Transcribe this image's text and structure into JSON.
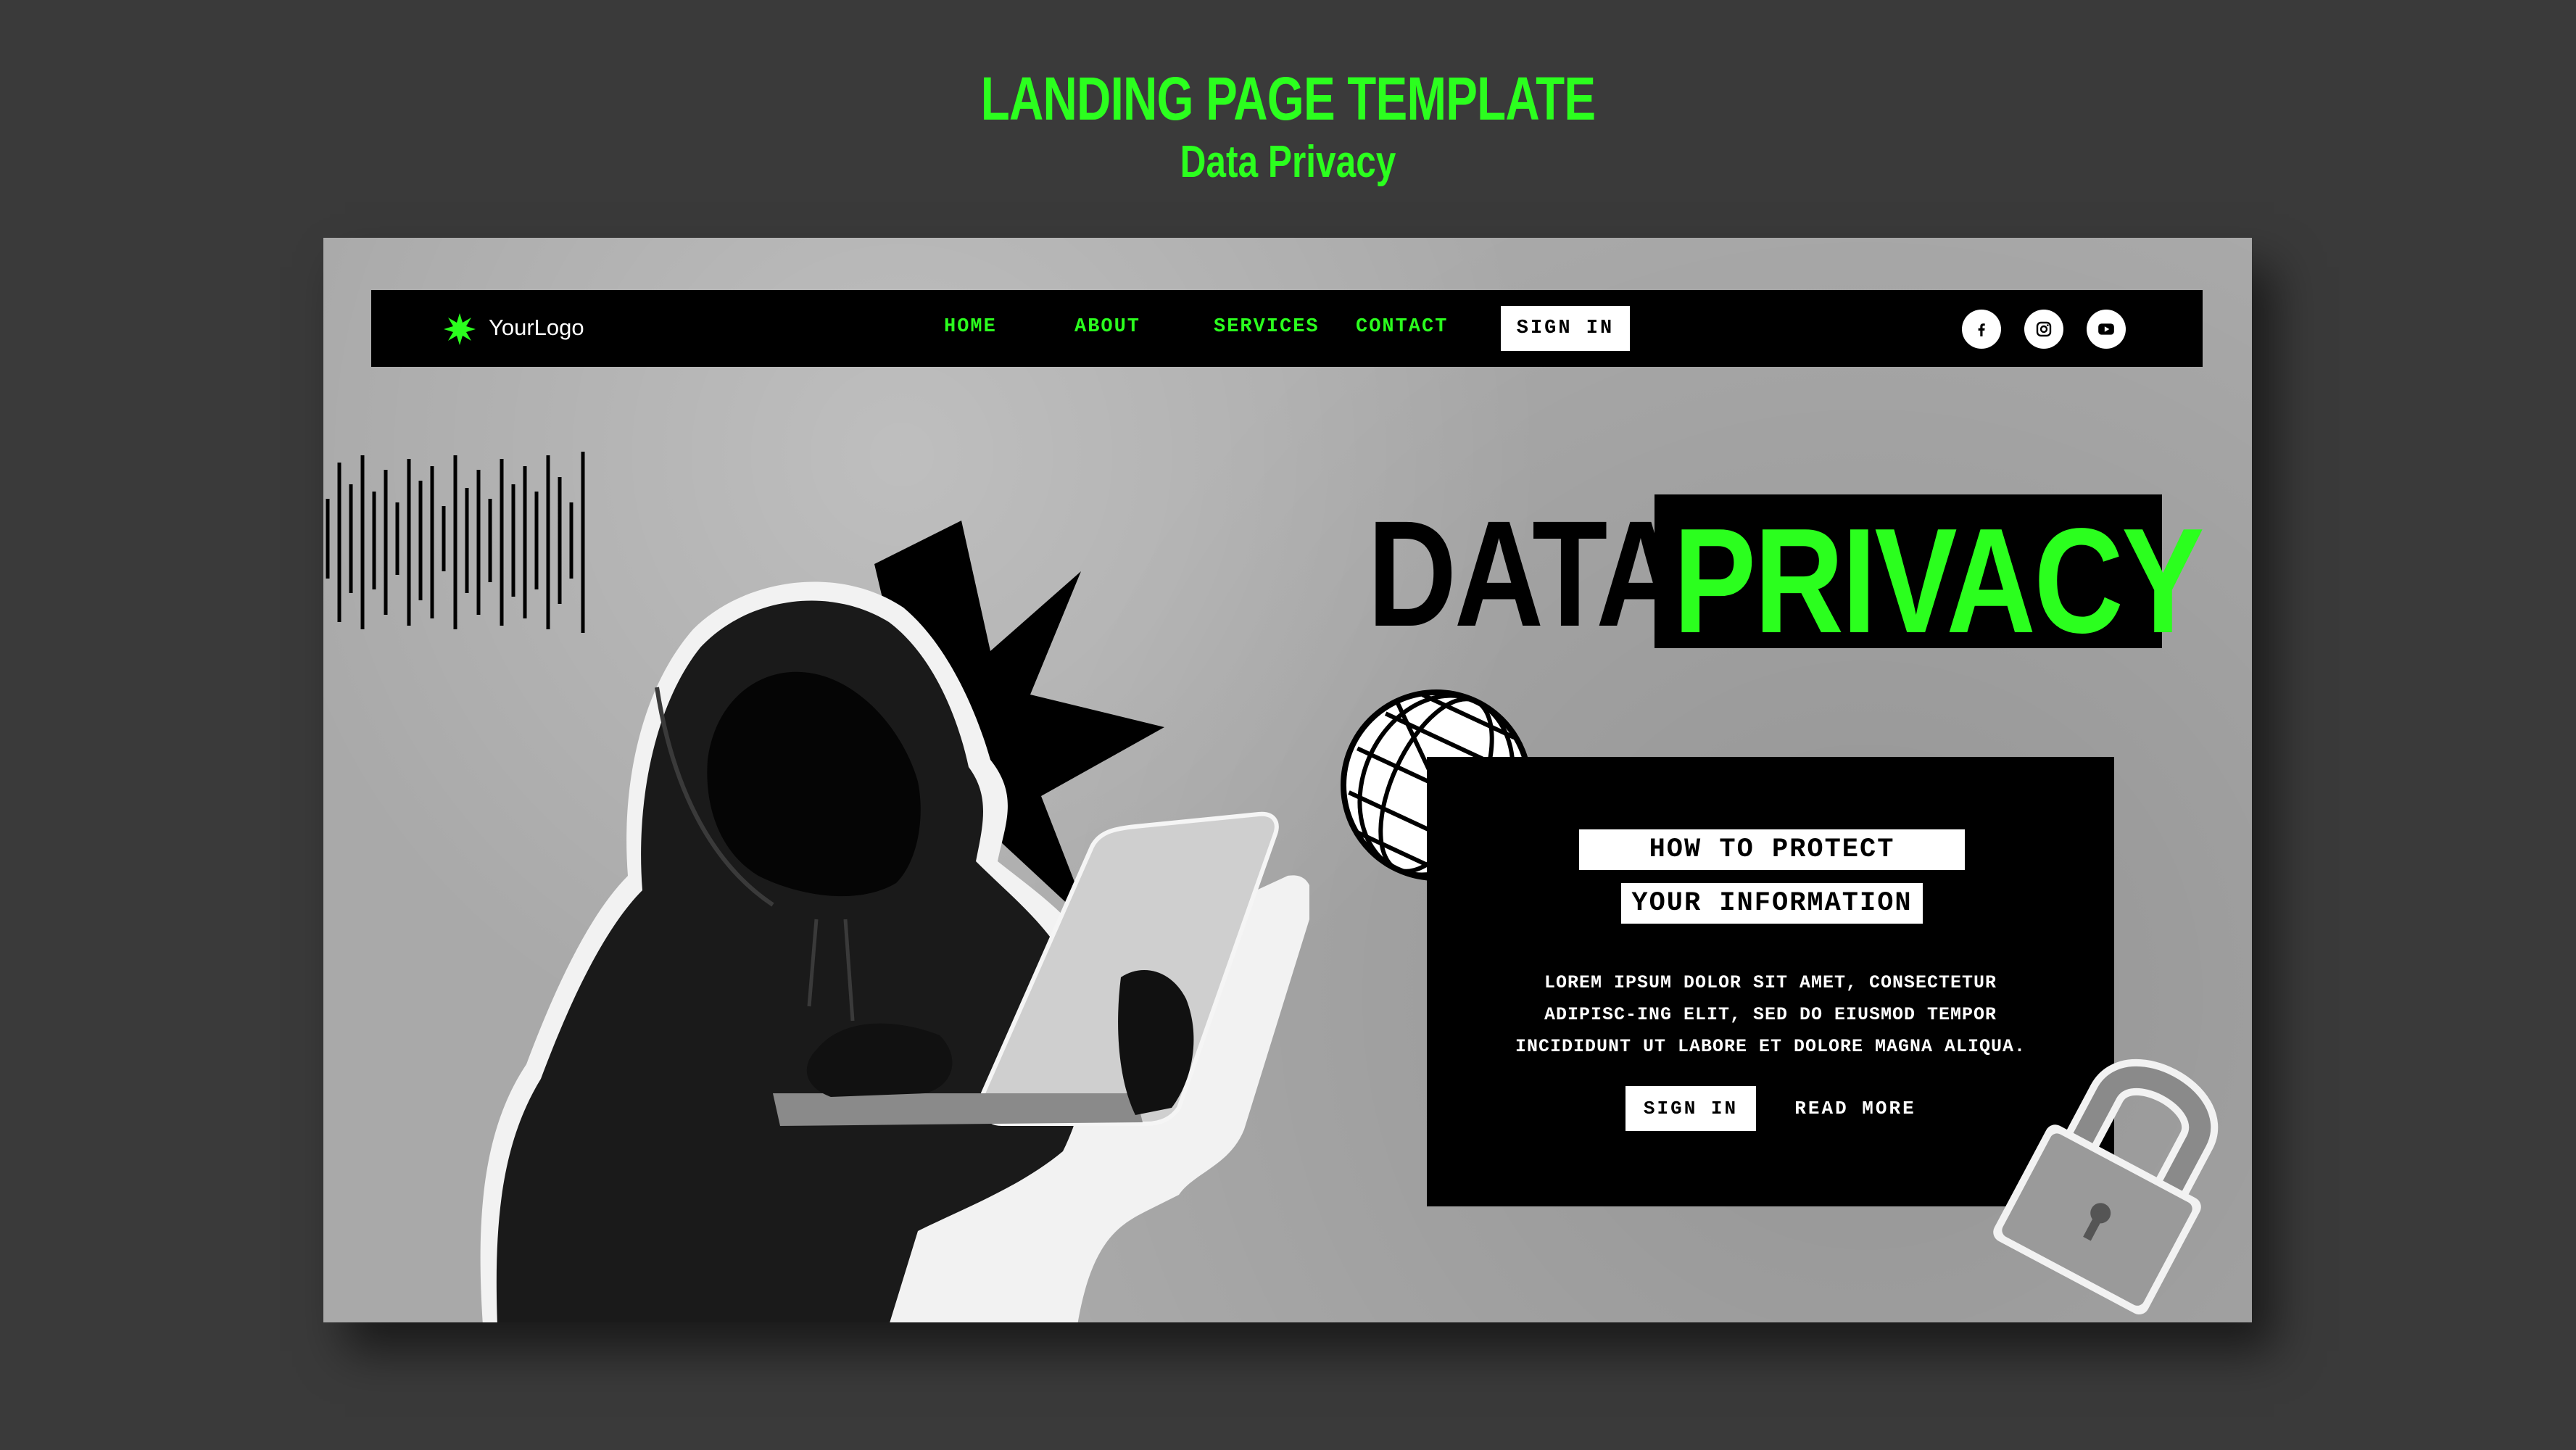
{
  "showcase": {
    "title": "LANDING PAGE TEMPLATE",
    "subtitle": "Data Privacy"
  },
  "colors": {
    "accent": "#2bff1e",
    "background": "#3a3a3a",
    "mockup": "#a9a9a9",
    "black": "#000000",
    "white": "#ffffff"
  },
  "navbar": {
    "logo_icon": "starburst-icon",
    "logo_text": "YourLogo",
    "links": [
      {
        "label": "HOME"
      },
      {
        "label": "ABOUT"
      },
      {
        "label": "SERVICES"
      },
      {
        "label": "CONTACT"
      }
    ],
    "sign_in": "SIGN IN",
    "social_icons": [
      "facebook-icon",
      "instagram-icon",
      "youtube-icon"
    ]
  },
  "hero": {
    "headline_word1": "DATA",
    "headline_word2": "PRIVACY"
  },
  "card": {
    "heading_line1": "HOW TO PROTECT",
    "heading_line2": "YOUR INFORMATION",
    "body": "LOREM IPSUM DOLOR SIT AMET, CONSECTETUR ADIPISC-ING ELIT, SED DO EIUSMOD TEMPOR INCIDIDUNT UT LABORE ET DOLORE MAGNA ALIQUA.",
    "sign_in": "SIGN IN",
    "read_more": "READ MORE"
  }
}
